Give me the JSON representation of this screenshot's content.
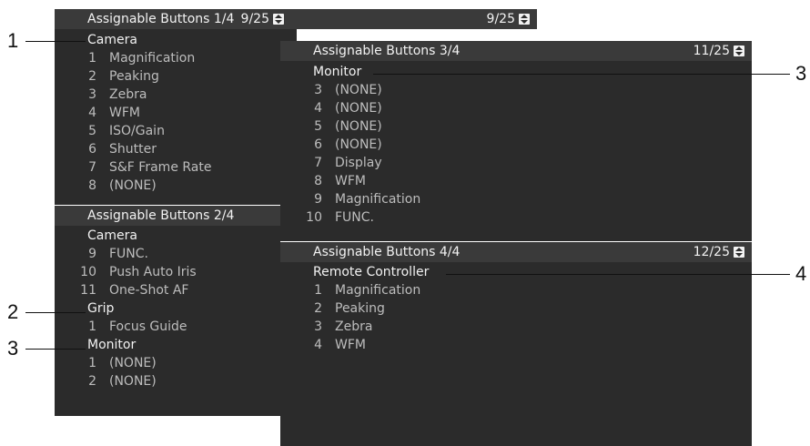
{
  "panel1": {
    "title": "Assignable Buttons 1/4",
    "page": "9/25",
    "rows": [
      {
        "kind": "cat",
        "text": "Camera"
      },
      {
        "kind": "item",
        "num": "1",
        "text": "Magnification"
      },
      {
        "kind": "item",
        "num": "2",
        "text": "Peaking"
      },
      {
        "kind": "item",
        "num": "3",
        "text": "Zebra"
      },
      {
        "kind": "item",
        "num": "4",
        "text": "WFM"
      },
      {
        "kind": "item",
        "num": "5",
        "text": "ISO/Gain"
      },
      {
        "kind": "item",
        "num": "6",
        "text": "Shutter"
      },
      {
        "kind": "item",
        "num": "7",
        "text": "S&F Frame Rate"
      },
      {
        "kind": "item",
        "num": "8",
        "text": "(NONE)"
      }
    ]
  },
  "panel2": {
    "title": "Assignable Buttons 2/4",
    "rows": [
      {
        "kind": "cat",
        "text": "Camera"
      },
      {
        "kind": "item",
        "num": "9",
        "text": "FUNC."
      },
      {
        "kind": "item",
        "num": "10",
        "text": "Push Auto Iris"
      },
      {
        "kind": "item",
        "num": "11",
        "text": "One-Shot AF"
      },
      {
        "kind": "cat",
        "text": "Grip"
      },
      {
        "kind": "item",
        "num": "1",
        "text": "Focus Guide"
      },
      {
        "kind": "cat",
        "text": "Monitor"
      },
      {
        "kind": "item",
        "num": "1",
        "text": "(NONE)"
      },
      {
        "kind": "item",
        "num": "2",
        "text": "(NONE)"
      }
    ]
  },
  "panel3": {
    "title": "Assignable Buttons 3/4",
    "page": "11/25",
    "rows": [
      {
        "kind": "cat",
        "text": "Monitor"
      },
      {
        "kind": "item",
        "num": "3",
        "text": "(NONE)"
      },
      {
        "kind": "item",
        "num": "4",
        "text": "(NONE)"
      },
      {
        "kind": "item",
        "num": "5",
        "text": "(NONE)"
      },
      {
        "kind": "item",
        "num": "6",
        "text": "(NONE)"
      },
      {
        "kind": "item",
        "num": "7",
        "text": "Display"
      },
      {
        "kind": "item",
        "num": "8",
        "text": "WFM"
      },
      {
        "kind": "item",
        "num": "9",
        "text": "Magnification"
      },
      {
        "kind": "item",
        "num": "10",
        "text": "FUNC."
      }
    ]
  },
  "panel4": {
    "title": "Assignable Buttons 4/4",
    "page": "12/25",
    "rows": [
      {
        "kind": "cat",
        "text": "Remote Controller"
      },
      {
        "kind": "item",
        "num": "1",
        "text": "Magnification"
      },
      {
        "kind": "item",
        "num": "2",
        "text": "Peaking"
      },
      {
        "kind": "item",
        "num": "3",
        "text": "Zebra"
      },
      {
        "kind": "item",
        "num": "4",
        "text": "WFM"
      }
    ]
  },
  "callouts": [
    "1",
    "2",
    "3",
    "3",
    "4"
  ],
  "colors": {
    "panel_bg": "#2b2b2b",
    "header_bg": "#3a3a3a",
    "text": "#e6e6e6",
    "item_text": "#bdbdbd"
  }
}
